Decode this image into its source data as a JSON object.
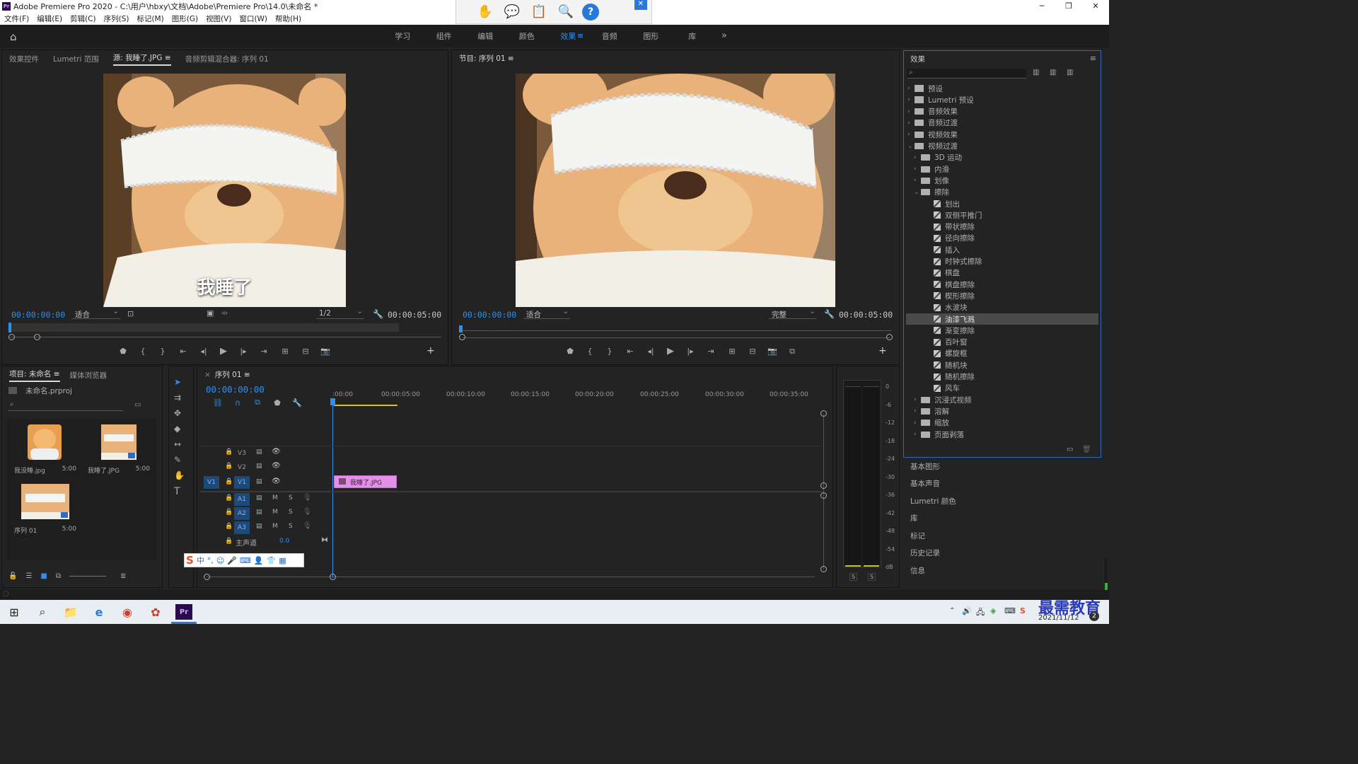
{
  "window": {
    "title": "Adobe Premiere Pro 2020 - C:\\用户\\hbxy\\文档\\Adobe\\Premiere Pro\\14.0\\未命名 *",
    "controls": [
      "─",
      "❐",
      "✕"
    ]
  },
  "menu": [
    "文件(F)",
    "编辑(E)",
    "剪辑(C)",
    "序列(S)",
    "标记(M)",
    "图形(G)",
    "视图(V)",
    "窗口(W)",
    "帮助(H)"
  ],
  "workspaces": {
    "tabs": [
      {
        "label": "学习",
        "active": false
      },
      {
        "label": "组件",
        "active": false
      },
      {
        "label": "编辑",
        "active": false
      },
      {
        "label": "颜色",
        "active": false
      },
      {
        "label": "效果",
        "active": true
      },
      {
        "label": "音频",
        "active": false
      },
      {
        "label": "图形",
        "active": false
      },
      {
        "label": "库",
        "active": false
      }
    ],
    "more": "»"
  },
  "source_panel": {
    "tabs": [
      "效果控件",
      "Lumetri 范围",
      "源: 我睡了.JPG",
      "音频剪辑混合器: 序列 01"
    ],
    "active_tab": 2,
    "caption": "我睡了",
    "timecode": "00:00:00:00",
    "fit": "适合",
    "resolution": "1/2",
    "duration": "00:00:05:00"
  },
  "program_panel": {
    "tab": "节目: 序列 01",
    "timecode": "00:00:00:00",
    "fit": "适合",
    "quality": "完整",
    "duration": "00:00:05:00"
  },
  "project_panel": {
    "tabs": [
      "项目: 未命名",
      "媒体浏览器"
    ],
    "project_file": "未命名.prproj",
    "items": [
      {
        "name": "我没睡.jpg",
        "duration": "5:00"
      },
      {
        "name": "我睡了.JPG",
        "duration": "5:00"
      },
      {
        "name": "序列 01",
        "duration": "5:00"
      }
    ]
  },
  "timeline": {
    "tab": "序列 01",
    "timecode": "00:00:00:00",
    "ruler": [
      ":00:00",
      "00:00:05:00",
      "00:00:10:00",
      "00:00:15:00",
      "00:00:20:00",
      "00:00:25:00",
      "00:00:30:00",
      "00:00:35:00"
    ],
    "video_tracks": [
      "V3",
      "V2",
      "V1"
    ],
    "audio_tracks": [
      "A1",
      "A2",
      "A3"
    ],
    "source_patch": "V1",
    "master_label": "主声道",
    "master_value": "0.0",
    "clip_label": "我睡了.JPG",
    "mute": "M",
    "solo": "S"
  },
  "meter": {
    "scale": [
      "0",
      "-6",
      "-12",
      "-18",
      "-24",
      "-30",
      "-36",
      "-42",
      "-48",
      "-54",
      "dB"
    ],
    "solo_buttons": [
      "S",
      "S"
    ]
  },
  "effects_panel": {
    "title": "效果",
    "tree": [
      {
        "label": "预设",
        "level": 0,
        "kind": "preset",
        "expanded": false
      },
      {
        "label": "Lumetri 预设",
        "level": 0,
        "kind": "preset",
        "expanded": false
      },
      {
        "label": "音频效果",
        "level": 0,
        "kind": "folder",
        "expanded": false
      },
      {
        "label": "音频过渡",
        "level": 0,
        "kind": "folder",
        "expanded": false
      },
      {
        "label": "视频效果",
        "level": 0,
        "kind": "folder",
        "expanded": false
      },
      {
        "label": "视频过渡",
        "level": 0,
        "kind": "folder",
        "expanded": true
      },
      {
        "label": "3D 运动",
        "level": 1,
        "kind": "folder",
        "expanded": false
      },
      {
        "label": "内滑",
        "level": 1,
        "kind": "folder",
        "expanded": false
      },
      {
        "label": "划像",
        "level": 1,
        "kind": "folder",
        "expanded": false
      },
      {
        "label": "擦除",
        "level": 1,
        "kind": "folder",
        "expanded": true
      },
      {
        "label": "划出",
        "level": 2,
        "kind": "fx"
      },
      {
        "label": "双侧平推门",
        "level": 2,
        "kind": "fx"
      },
      {
        "label": "带状擦除",
        "level": 2,
        "kind": "fx"
      },
      {
        "label": "径向擦除",
        "level": 2,
        "kind": "fx"
      },
      {
        "label": "插入",
        "level": 2,
        "kind": "fx"
      },
      {
        "label": "时钟式擦除",
        "level": 2,
        "kind": "fx"
      },
      {
        "label": "棋盘",
        "level": 2,
        "kind": "fx"
      },
      {
        "label": "棋盘擦除",
        "level": 2,
        "kind": "fx"
      },
      {
        "label": "楔形擦除",
        "level": 2,
        "kind": "fx"
      },
      {
        "label": "水波块",
        "level": 2,
        "kind": "fx"
      },
      {
        "label": "油漆飞溅",
        "level": 2,
        "kind": "fx",
        "selected": true
      },
      {
        "label": "渐变擦除",
        "level": 2,
        "kind": "fx"
      },
      {
        "label": "百叶窗",
        "level": 2,
        "kind": "fx"
      },
      {
        "label": "螺旋框",
        "level": 2,
        "kind": "fx"
      },
      {
        "label": "随机块",
        "level": 2,
        "kind": "fx"
      },
      {
        "label": "随机擦除",
        "level": 2,
        "kind": "fx"
      },
      {
        "label": "风车",
        "level": 2,
        "kind": "fx"
      },
      {
        "label": "沉浸式视频",
        "level": 1,
        "kind": "folder",
        "expanded": false
      },
      {
        "label": "溶解",
        "level": 1,
        "kind": "folder",
        "expanded": false
      },
      {
        "label": "缩放",
        "level": 1,
        "kind": "folder",
        "expanded": false
      },
      {
        "label": "页面剥落",
        "level": 1,
        "kind": "folder",
        "expanded": false
      }
    ]
  },
  "side_panels": [
    "基本图形",
    "基本声音",
    "Lumetri 颜色",
    "库",
    "标记",
    "历史记录",
    "信息"
  ],
  "ime_toolbar": [
    "S",
    "中",
    "°,",
    "☺",
    "🎤",
    "⌨",
    "👤",
    "👕",
    "▦"
  ],
  "tray": {
    "date": "2021/11/12",
    "watermark": "最需教育",
    "badge": "2"
  },
  "colors": {
    "accent": "#2e8ff0",
    "clip": "#e590e8",
    "panel_bg": "#232323",
    "selected_row": "#4a4a4a"
  }
}
